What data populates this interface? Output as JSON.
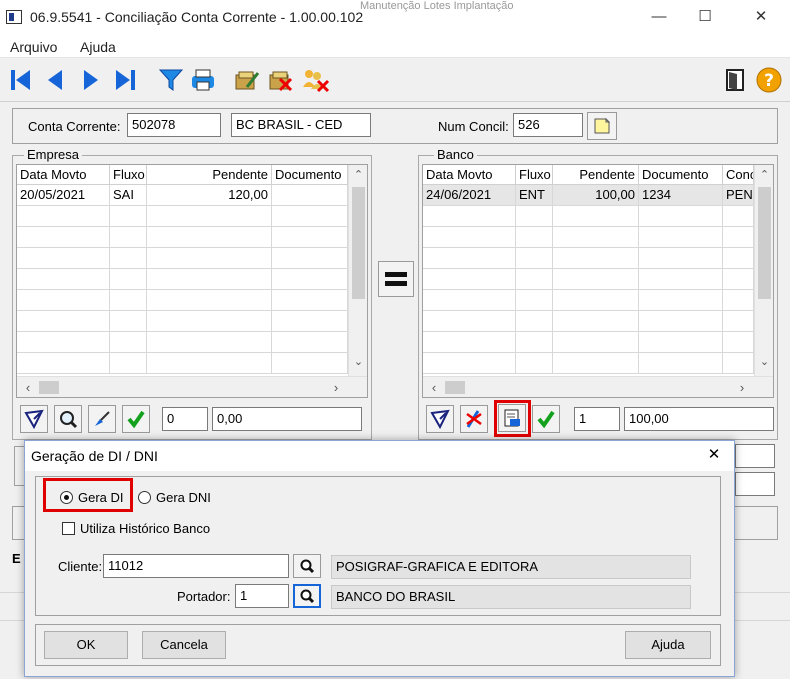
{
  "window": {
    "title": "06.9.5541 - Conciliação Conta Corrente - 1.00.00.102",
    "minimize": "—",
    "maximize": "☐",
    "close": "✕"
  },
  "menu": [
    "Arquivo",
    "Ajuda"
  ],
  "form": {
    "conta_label": "Conta Corrente:",
    "conta_value": "502078",
    "banco_nome": "BC BRASIL - CED",
    "num_concil_label": "Num Concil:",
    "num_concil_value": "526",
    "equal_sign": "="
  },
  "empresa": {
    "title": "Empresa",
    "columns": [
      "Data Movto",
      "Fluxo",
      "Pendente",
      "Documento"
    ],
    "rows": [
      [
        "20/05/2021",
        "SAI",
        "120,00",
        ""
      ]
    ],
    "count": "0",
    "total": "0,00"
  },
  "banco": {
    "title": "Banco",
    "columns": [
      "Data Movto",
      "Fluxo",
      "Pendente",
      "Documento",
      "Conc"
    ],
    "rows": [
      [
        "24/06/2021",
        "ENT",
        "100,00",
        "1234",
        "PEN"
      ]
    ],
    "count": "1",
    "total": "100,00"
  },
  "dialog": {
    "title": "Geração de DI / DNI",
    "close": "✕",
    "gera_di": "Gera DI",
    "gera_dni": "Gera DNI",
    "utiliza_historico": "Utiliza Histórico Banco",
    "cliente_label": "Cliente:",
    "cliente_value": "11012",
    "cliente_nome": "POSIGRAF-GRAFICA E EDITORA",
    "portador_label": "Portador:",
    "portador_value": "1",
    "portador_nome": "BANCO DO BRASIL",
    "ok": "OK",
    "cancela": "Cancela",
    "ajuda": "Ajuda"
  },
  "background": {
    "behind_title": "Manutenção Lotes Implantação",
    "behind_letter": "E"
  },
  "colors": {
    "accent_blue": "#1565d8",
    "highlight_red": "#e00000",
    "check_green": "#14a21e",
    "help_orange": "#f2a200"
  }
}
